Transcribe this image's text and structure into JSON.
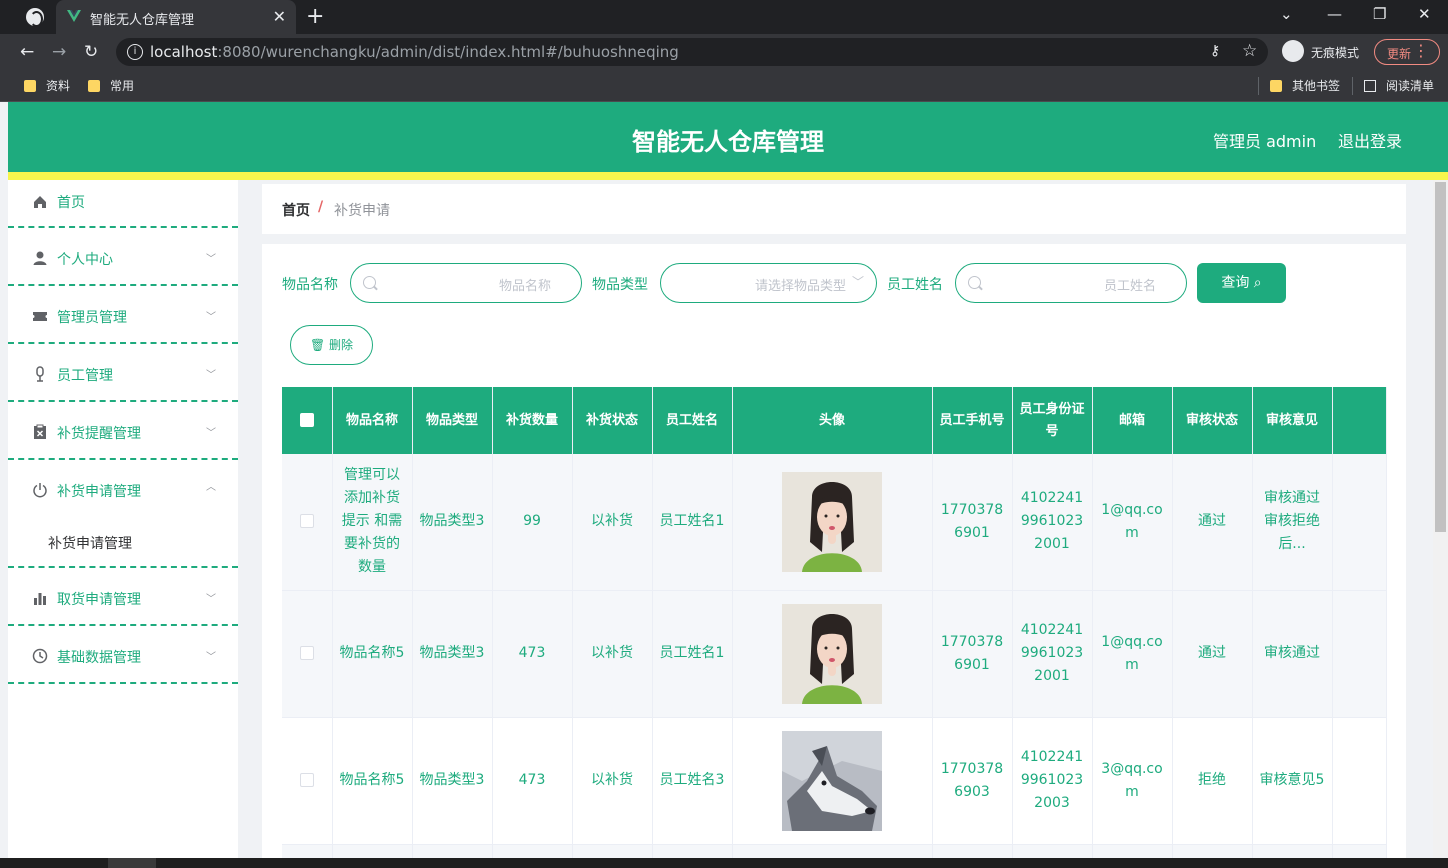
{
  "browser": {
    "tab_title": "智能无人仓库管理",
    "url_host": "localhost",
    "url_rest": ":8080/wurenchangku/admin/dist/index.html#/buhuoshneqing",
    "incognito_label": "无痕模式",
    "update_label": "更新",
    "bookmarks": [
      "资料",
      "常用"
    ],
    "other_bookmarks": "其他书签",
    "reading_list": "阅读清单"
  },
  "header": {
    "title": "智能无人仓库管理",
    "user": "管理员 admin",
    "logout": "退出登录"
  },
  "sidebar": {
    "items": [
      {
        "label": "首页",
        "icon": "home-icon"
      },
      {
        "label": "个人中心",
        "icon": "user-icon"
      },
      {
        "label": "管理员管理",
        "icon": "ticket-icon"
      },
      {
        "label": "员工管理",
        "icon": "microphone-icon"
      },
      {
        "label": "补货提醒管理",
        "icon": "clipboard-x-icon"
      },
      {
        "label": "补货申请管理",
        "icon": "power-icon"
      },
      {
        "label": "取货申请管理",
        "icon": "bar-chart-icon"
      },
      {
        "label": "基础数据管理",
        "icon": "clock-icon"
      }
    ],
    "submenu_label": "补货申请管理"
  },
  "breadcrumb": {
    "home": "首页",
    "separator": "/",
    "current": "补货申请"
  },
  "filters": {
    "name_label": "物品名称",
    "name_placeholder": "物品名称",
    "type_label": "物品类型",
    "type_placeholder": "请选择物品类型",
    "staff_label": "员工姓名",
    "staff_placeholder": "员工姓名",
    "query_label": "查询",
    "delete_label": "删除"
  },
  "table": {
    "headers": [
      "物品名称",
      "物品类型",
      "补货数量",
      "补货状态",
      "员工姓名",
      "头像",
      "员工手机号",
      "员工身份证号",
      "邮箱",
      "审核状态",
      "审核意见"
    ],
    "rows": [
      {
        "name": "管理可以添加补货提示 和需要补货的数量",
        "type": "物品类型3",
        "qty": "99",
        "status": "以补货",
        "staff": "员工姓名1",
        "avatar": "girl",
        "phone": "17703786901",
        "idcard": "410224199610232001",
        "email": "1@qq.com",
        "audit": "通过",
        "opinion": "审核通过审核拒绝后..."
      },
      {
        "name": "物品名称5",
        "type": "物品类型3",
        "qty": "473",
        "status": "以补货",
        "staff": "员工姓名1",
        "avatar": "girl",
        "phone": "17703786901",
        "idcard": "410224199610232001",
        "email": "1@qq.com",
        "audit": "通过",
        "opinion": "审核通过"
      },
      {
        "name": "物品名称5",
        "type": "物品类型3",
        "qty": "473",
        "status": "以补货",
        "staff": "员工姓名3",
        "avatar": "husky",
        "phone": "17703786903",
        "idcard": "410224199610232003",
        "email": "3@qq.com",
        "audit": "拒绝",
        "opinion": "审核意见5"
      }
    ]
  },
  "colors": {
    "primary": "#1eab7e",
    "accent_line": "#f8f64d"
  }
}
